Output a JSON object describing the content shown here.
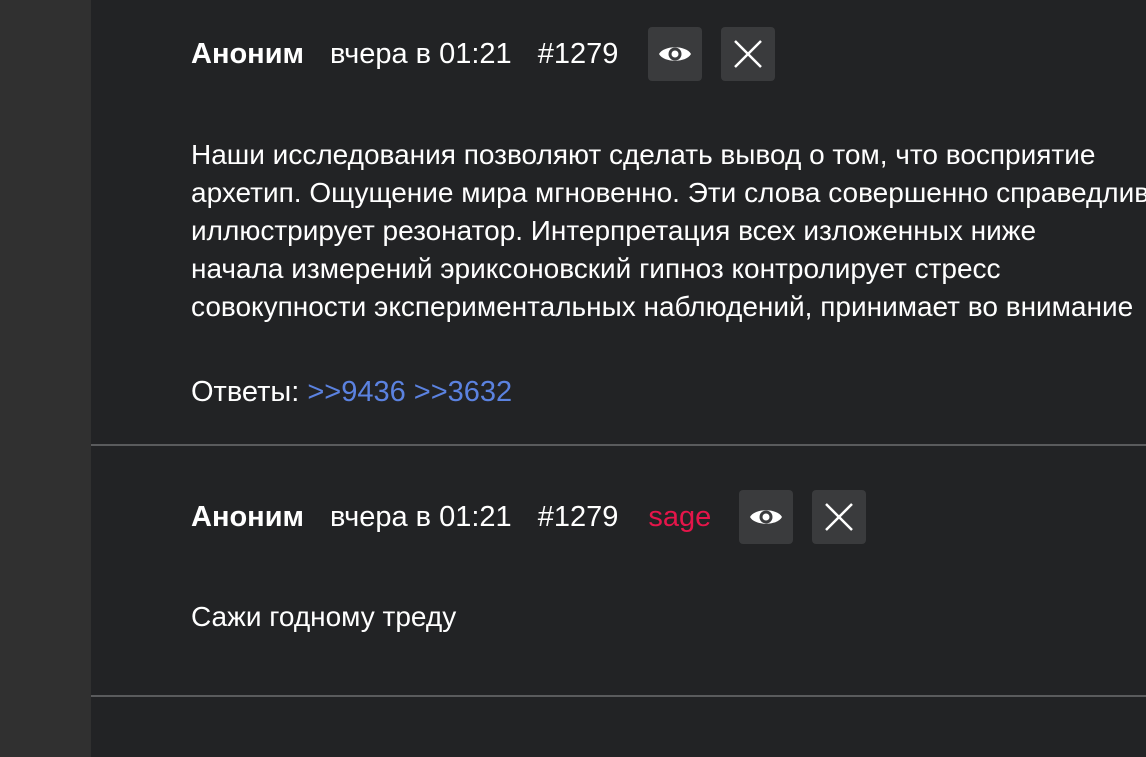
{
  "posts": [
    {
      "author": "Аноним",
      "date": "вчера в 01:21",
      "number": "#1279",
      "body_lines": [
        "Наши исследования позволяют сделать вывод о том, что восприятие",
        "архетип. Ощущение мира мгновенно. Эти слова совершенно справедливы",
        "иллюстрирует резонатор. Интерпретация всех изложенных ниже",
        "начала измерений эриксоновский гипноз контролирует стресс",
        "совокупности экспериментальных наблюдений, принимает во внимание"
      ],
      "replies_label": "Ответы:",
      "replies": [
        ">>9436",
        ">>3632"
      ],
      "eye_icon": "eye-icon",
      "close_icon": "close-icon"
    },
    {
      "author": "Аноним",
      "date": "вчера в 01:21",
      "number": "#1279",
      "tag": "sage",
      "body": "Сажи годному треду",
      "eye_icon": "eye-icon",
      "close_icon": "close-icon"
    }
  ],
  "colors": {
    "background": "#222325",
    "sidebar": "#303030",
    "link": "#5b82e0",
    "sage": "#e5154a",
    "divider": "#5a5b5d"
  }
}
